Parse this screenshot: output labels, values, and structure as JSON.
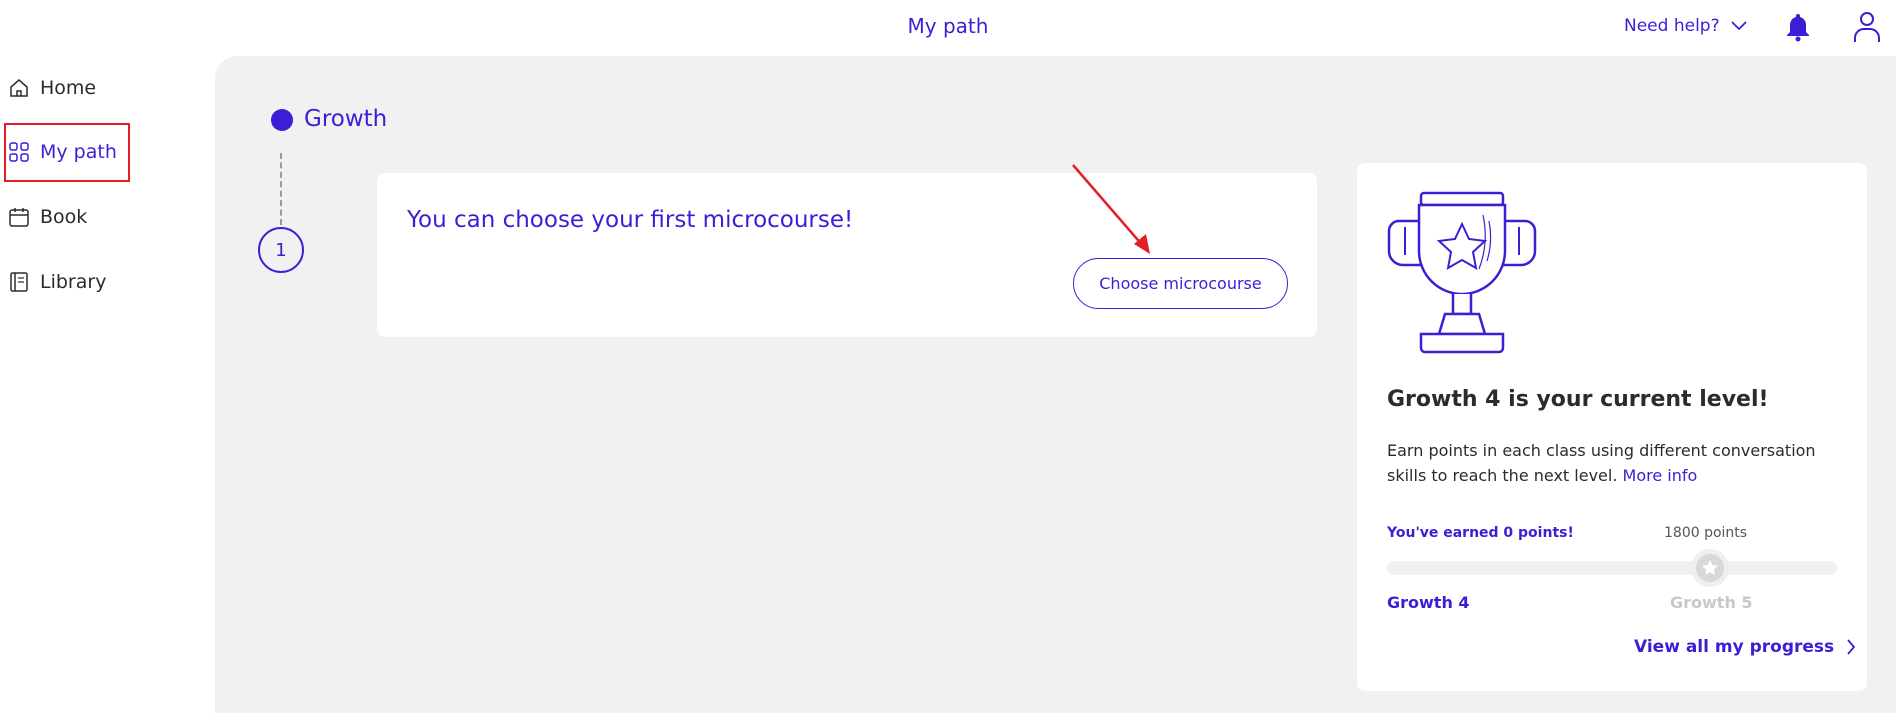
{
  "header": {
    "title": "My path",
    "help_label": "Need help?"
  },
  "sidebar": {
    "items": [
      {
        "label": "Home",
        "icon": "home-icon"
      },
      {
        "label": "My path",
        "icon": "grid-icon",
        "active": true
      },
      {
        "label": "Book",
        "icon": "calendar-icon"
      },
      {
        "label": "Library",
        "icon": "book-icon"
      }
    ]
  },
  "path": {
    "section_label": "Growth",
    "step_number": "1",
    "card_title": "You can choose your first microcourse!",
    "button_label": "Choose microcourse"
  },
  "level": {
    "title": "Growth 4 is your current level!",
    "description": "Earn points in each class using different conversation skills to reach the next level.",
    "more_info": "More info",
    "earned": "You've earned 0 points!",
    "goal": "1800 points",
    "current_level": "Growth 4",
    "next_level": "Growth 5",
    "progress_fraction": 0,
    "view_progress": "View all my progress"
  },
  "colors": {
    "accent": "#3b1fd6",
    "annotation": "#e41e26",
    "background": "#f1f1f1"
  }
}
